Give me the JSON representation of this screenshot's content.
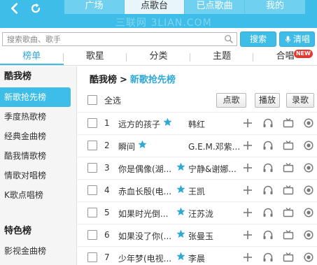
{
  "topbar": {
    "tabs": [
      {
        "label": "广场",
        "active": false
      },
      {
        "label": "点歌台",
        "active": true
      },
      {
        "label": "已点歌曲",
        "active": false
      },
      {
        "label": "我的",
        "active": false
      }
    ],
    "watermark": "三联网 3LIAN.COM"
  },
  "search": {
    "placeholder": "搜索歌曲、歌手",
    "search_label": "搜索",
    "clear_label": "清唱"
  },
  "categories": [
    {
      "label": "榜单",
      "active": true
    },
    {
      "label": "歌星",
      "active": false
    },
    {
      "label": "分类",
      "active": false
    },
    {
      "label": "主题",
      "active": false
    },
    {
      "label": "合唱",
      "active": false,
      "badge": "NEW"
    }
  ],
  "sidebar": {
    "heading": "酷我榜",
    "items": [
      "新歌抢先榜",
      "季度热歌榜",
      "经典金曲榜",
      "酷我情歌榜",
      "情歌对唱榜",
      "K歌点唱榜"
    ],
    "active_index": 0,
    "heading2": "特色榜",
    "item2": "影视金曲榜"
  },
  "main": {
    "crumb_root": "酷我榜",
    "crumb_arrow": ">",
    "crumb_current": "新歌抢先榜",
    "select_all": "全选",
    "btn_request": "点歌",
    "btn_play": "播放",
    "btn_record": "录歌"
  },
  "songs": [
    {
      "num": "1",
      "title": "远方的孩子",
      "artist": "韩红"
    },
    {
      "num": "2",
      "title": "瞬间",
      "artist": "G.E.M.邓紫..."
    },
    {
      "num": "3",
      "title": "你是偶像(湖...",
      "artist": "宁静&谢娜..."
    },
    {
      "num": "4",
      "title": "赤血长殷(电...",
      "artist": "王凯"
    },
    {
      "num": "5",
      "title": "如果时光倒...",
      "artist": "汪苏泷"
    },
    {
      "num": "6",
      "title": "如果没了你(...",
      "artist": "张曼玉"
    },
    {
      "num": "7",
      "title": "少年梦(电视...",
      "artist": "李晨"
    }
  ],
  "colors": {
    "accent": "#3dbde7",
    "star": "#2fa8d6",
    "badge": "#e8362e"
  }
}
